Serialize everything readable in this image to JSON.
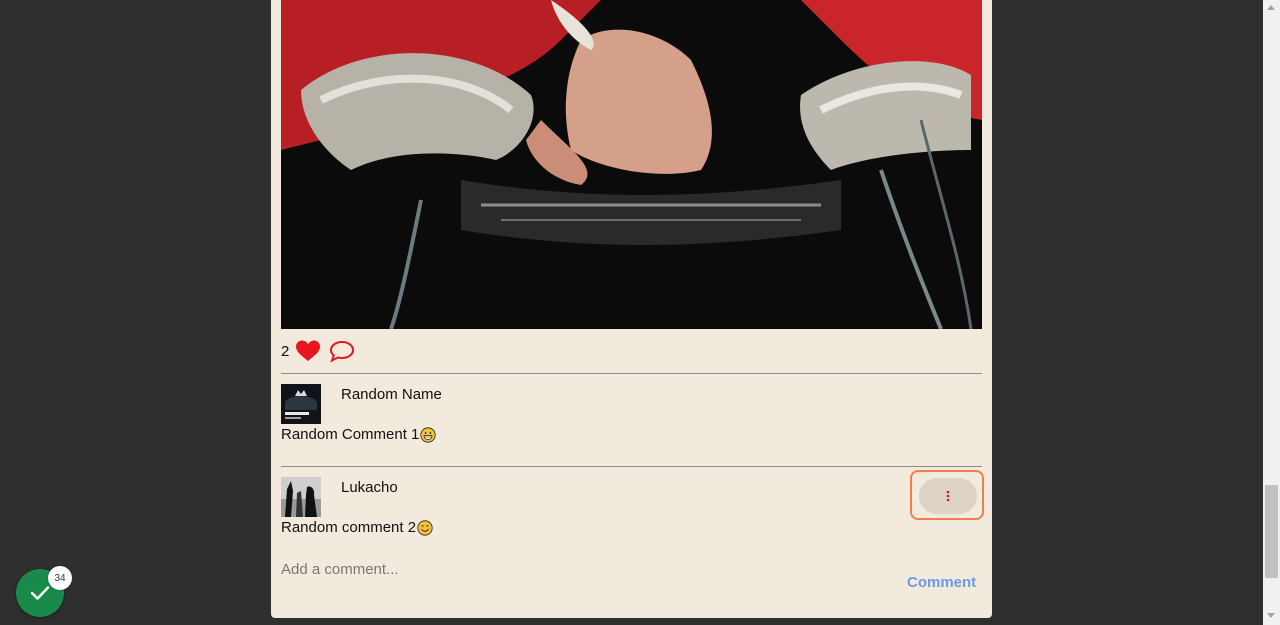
{
  "post": {
    "image_alt": "Post image",
    "like_count": "2"
  },
  "comments": [
    {
      "username": "Random Name",
      "text": "Random Comment 1",
      "emoji": "grinning-face"
    },
    {
      "username": "Lukacho",
      "text": "Random comment 2",
      "emoji": "smiling-face"
    }
  ],
  "add_comment": {
    "placeholder": "Add a comment...",
    "button_label": "Comment"
  },
  "notification_badge": {
    "count": "34"
  },
  "colors": {
    "background": "#2f2f2f",
    "card": "#f2eadc",
    "heart": "#e8161e",
    "comment_link": "#6b9be8",
    "focus_ring": "#f07f4f",
    "fab": "#1a8a4a"
  }
}
